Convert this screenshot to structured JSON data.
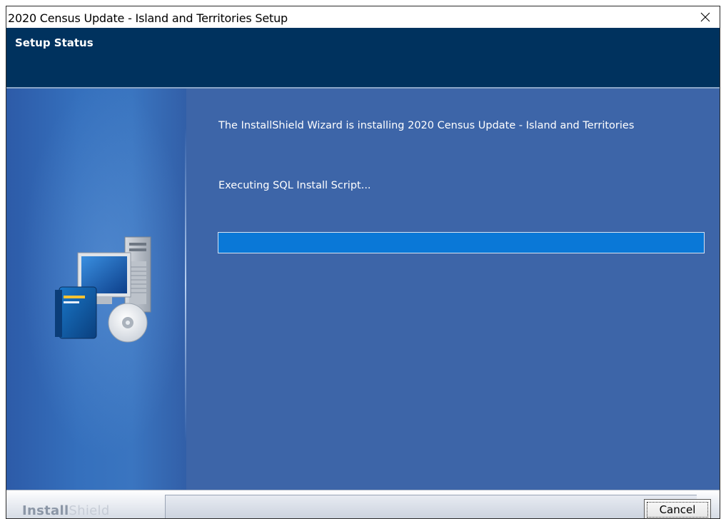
{
  "window": {
    "title": "2020 Census Update - Island and Territories Setup"
  },
  "header": {
    "heading": "Setup Status"
  },
  "main": {
    "status_message": "The InstallShield Wizard is installing 2020 Census Update - Island and Territories",
    "action_text": "Executing SQL Install Script...",
    "progress_fraction": 1.0
  },
  "footer": {
    "brand_part1": "Install",
    "brand_part2": "Shield",
    "cancel_label": "Cancel"
  },
  "icons": {
    "close": "close-icon",
    "artwork": "computer-cd-icon"
  },
  "colors": {
    "header_bg": "#00325e",
    "body_bg": "#3d65a8",
    "progress_fill": "#0a78d7"
  }
}
